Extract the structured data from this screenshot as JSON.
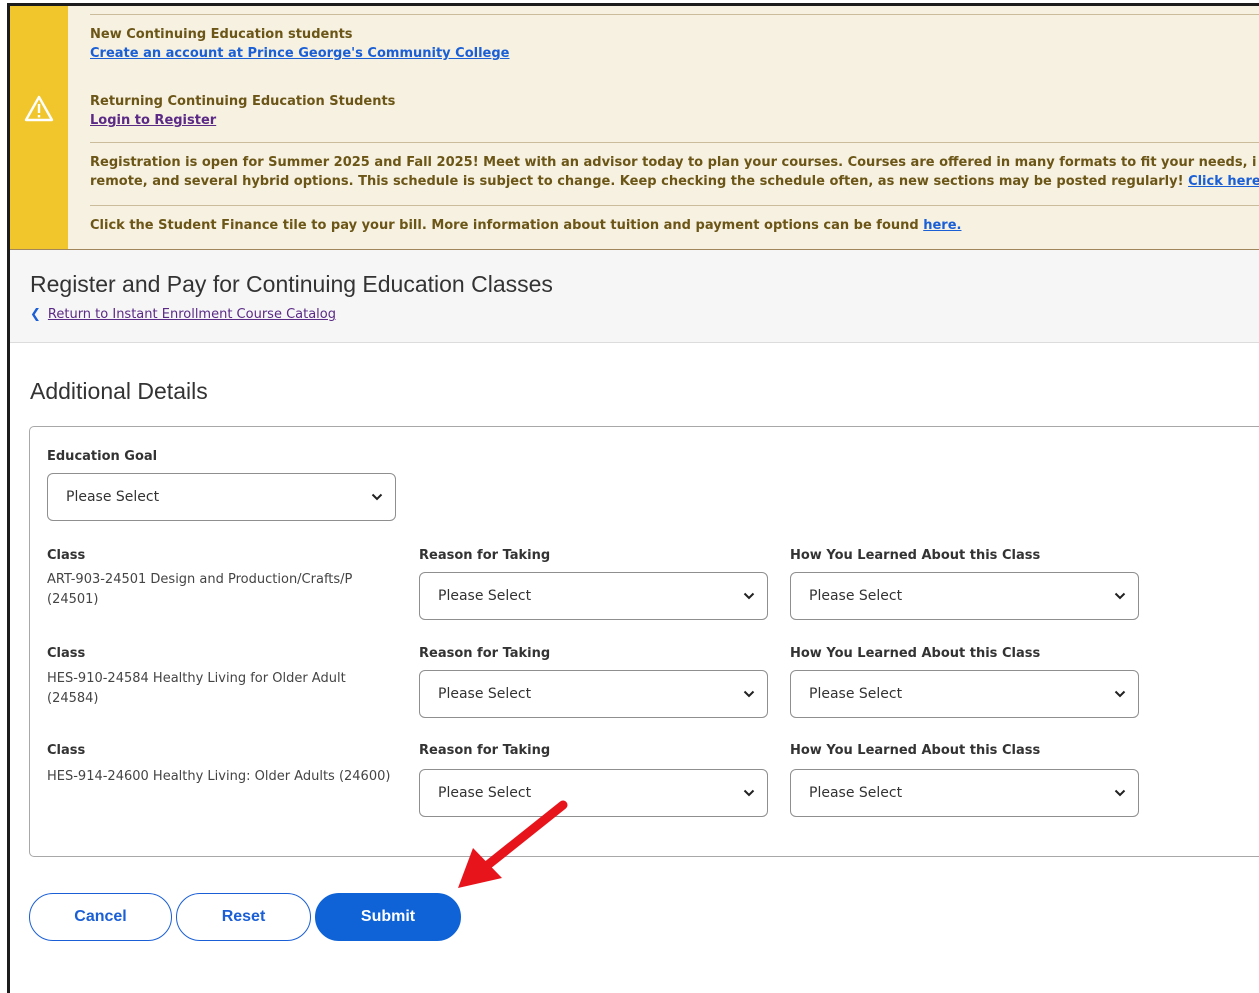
{
  "alert": {
    "icon": "warning-triangle-icon",
    "new_students_heading": "New Continuing Education students",
    "create_account_link": "Create an account at Prince George's Community College",
    "returning_heading": "Returning Continuing Education Students",
    "login_link": "Login to Register",
    "registration_line1": "Registration is open for Summer 2025 and Fall 2025! Meet with an advisor today to plan your courses. Courses are offered in many formats to fit your needs, i",
    "registration_line2": "remote, and several hybrid options. This schedule is subject to change. Keep checking the schedule often, as new sections may be posted regularly!",
    "click_here_link": "Click here",
    "finance_text": "Click the Student Finance tile to pay your bill. More information about tuition and payment options can be found",
    "here_link": "here.",
    "colors": {
      "stripe": "#f0c62c",
      "background": "#f7f1e1",
      "text": "#6b5617"
    }
  },
  "header": {
    "title": "Register and Pay for Continuing Education Classes",
    "back_link": "Return to Instant Enrollment Course Catalog"
  },
  "section": {
    "title": "Additional Details",
    "education_goal_label": "Education Goal",
    "education_goal_value": "Please Select",
    "rows": [
      {
        "class_label": "Class",
        "class_name": "ART-903-24501 Design and Production/Crafts/P (24501)",
        "reason_label": "Reason for Taking",
        "reason_value": "Please Select",
        "learned_label": "How You Learned About this Class",
        "learned_value": "Please Select"
      },
      {
        "class_label": "Class",
        "class_name": "HES-910-24584 Healthy Living for Older Adult (24584)",
        "reason_label": "Reason for Taking",
        "reason_value": "Please Select",
        "learned_label": "How You Learned About this Class",
        "learned_value": "Please Select"
      },
      {
        "class_label": "Class",
        "class_name": "HES-914-24600 Healthy Living: Older Adults (24600)",
        "reason_label": "Reason for Taking",
        "reason_value": "Please Select",
        "learned_label": "How You Learned About this Class",
        "learned_value": "Please Select"
      }
    ]
  },
  "buttons": {
    "cancel": "Cancel",
    "reset": "Reset",
    "submit": "Submit",
    "primary_color": "#0f63d6"
  },
  "annotation": {
    "arrow_color": "#e8141b",
    "arrow_target": "submit-button"
  }
}
